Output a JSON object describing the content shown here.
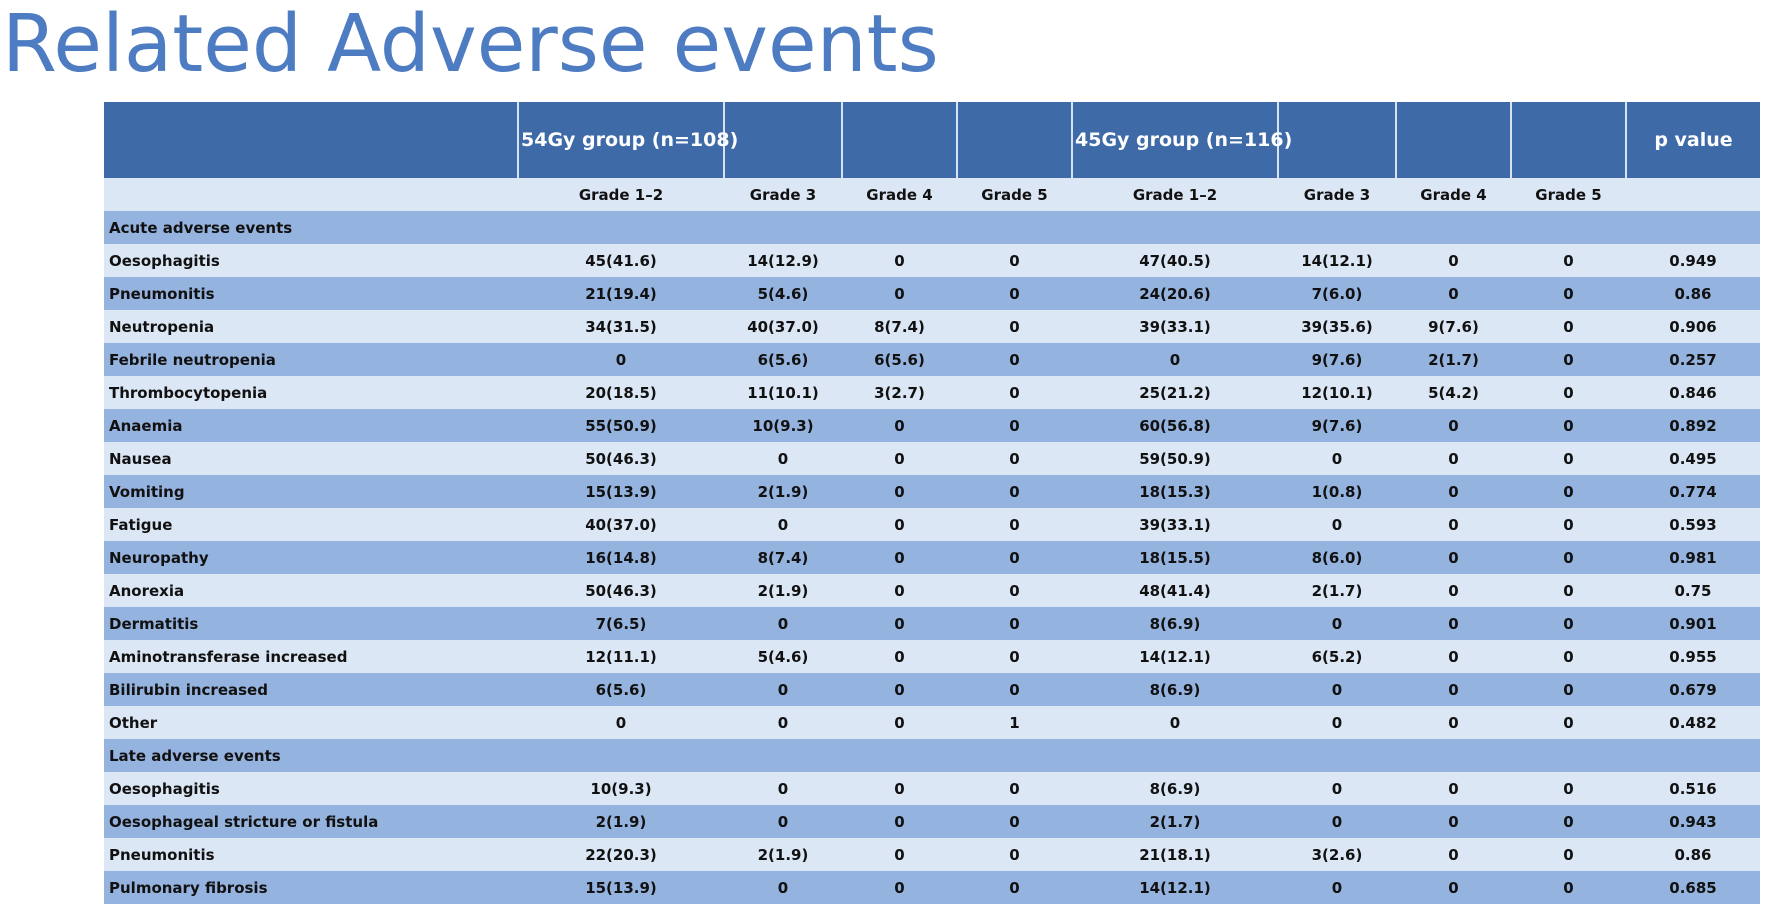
{
  "title": "Related Adverse events",
  "table": {
    "group_headers": [
      "",
      "54Gy  group  (n=108)",
      "",
      "",
      "",
      "45Gy  group  (n=116)",
      "",
      "",
      "",
      "p value"
    ],
    "grade_headers": [
      "",
      "Grade  1–2",
      "Grade  3",
      "Grade  4",
      "Grade  5",
      "Grade  1–2",
      "Grade  3",
      "Grade  4",
      "Grade  5",
      ""
    ],
    "rows": [
      {
        "kind": "section",
        "cells": [
          "Acute  adverse  events",
          "",
          "",
          "",
          "",
          "",
          "",
          "",
          "",
          ""
        ]
      },
      {
        "kind": "light",
        "cells": [
          "Oesophagitis",
          "45(41.6)",
          "14(12.9)",
          "0",
          "0",
          "47(40.5)",
          "14(12.1)",
          "0",
          "0",
          "0.949"
        ]
      },
      {
        "kind": "dark",
        "cells": [
          "Pneumonitis",
          "21(19.4)",
          "5(4.6)",
          "0",
          "0",
          "24(20.6)",
          "7(6.0)",
          "0",
          "0",
          "0.86"
        ]
      },
      {
        "kind": "light",
        "cells": [
          "Neutropenia",
          "34(31.5)",
          "40(37.0)",
          "8(7.4)",
          "0",
          "39(33.1)",
          "39(35.6)",
          "9(7.6)",
          "0",
          "0.906"
        ]
      },
      {
        "kind": "dark",
        "cells": [
          "Febrile  neutropenia",
          "0",
          "6(5.6)",
          "6(5.6)",
          "0",
          "0",
          "9(7.6)",
          "2(1.7)",
          "0",
          "0.257"
        ]
      },
      {
        "kind": "light",
        "cells": [
          "Thrombocytopenia",
          "20(18.5)",
          "11(10.1)",
          "3(2.7)",
          "0",
          "25(21.2)",
          "12(10.1)",
          "5(4.2)",
          "0",
          "0.846"
        ]
      },
      {
        "kind": "dark",
        "cells": [
          "Anaemia",
          "55(50.9)",
          "10(9.3)",
          "0",
          "0",
          "60(56.8)",
          "9(7.6)",
          "0",
          "0",
          "0.892"
        ]
      },
      {
        "kind": "light",
        "cells": [
          "Nausea",
          "50(46.3)",
          "0",
          "0",
          "0",
          "59(50.9)",
          "0",
          "0",
          "0",
          "0.495"
        ]
      },
      {
        "kind": "dark",
        "cells": [
          "Vomiting",
          "15(13.9)",
          "2(1.9)",
          "0",
          "0",
          "18(15.3)",
          "1(0.8)",
          "0",
          "0",
          "0.774"
        ]
      },
      {
        "kind": "light",
        "cells": [
          "Fatigue",
          "40(37.0)",
          "0",
          "0",
          "0",
          "39(33.1)",
          "0",
          "0",
          "0",
          "0.593"
        ]
      },
      {
        "kind": "dark",
        "cells": [
          "Neuropathy",
          "16(14.8)",
          "8(7.4)",
          "0",
          "0",
          "18(15.5)",
          "8(6.0)",
          "0",
          "0",
          "0.981"
        ]
      },
      {
        "kind": "light",
        "cells": [
          "Anorexia",
          "50(46.3)",
          "2(1.9)",
          "0",
          "0",
          "48(41.4)",
          "2(1.7)",
          "0",
          "0",
          "0.75"
        ]
      },
      {
        "kind": "dark",
        "cells": [
          "Dermatitis",
          "7(6.5)",
          "0",
          "0",
          "0",
          "8(6.9)",
          "0",
          "0",
          "0",
          "0.901"
        ]
      },
      {
        "kind": "light",
        "cells": [
          "Aminotransferase  increased",
          "12(11.1)",
          "5(4.6)",
          "0",
          "0",
          "14(12.1)",
          "6(5.2)",
          "0",
          "0",
          "0.955"
        ]
      },
      {
        "kind": "dark",
        "cells": [
          "Bilirubin  increased",
          "6(5.6)",
          "0",
          "0",
          "0",
          "8(6.9)",
          "0",
          "0",
          "0",
          "0.679"
        ]
      },
      {
        "kind": "light",
        "cells": [
          "Other",
          "0",
          "0",
          "0",
          "1",
          "0",
          "0",
          "0",
          "0",
          "0.482"
        ]
      },
      {
        "kind": "section",
        "cells": [
          "Late  adverse  events",
          "",
          "",
          "",
          "",
          "",
          "",
          "",
          "",
          ""
        ]
      },
      {
        "kind": "light",
        "cells": [
          "Oesophagitis",
          "10(9.3)",
          "0",
          "0",
          "0",
          "8(6.9)",
          "0",
          "0",
          "0",
          "0.516"
        ]
      },
      {
        "kind": "dark",
        "cells": [
          "Oesophageal  stricture  or  fistula",
          "2(1.9)",
          "0",
          "0",
          "0",
          "2(1.7)",
          "0",
          "0",
          "0",
          "0.943"
        ]
      },
      {
        "kind": "light",
        "cells": [
          "Pneumonitis",
          "22(20.3)",
          "2(1.9)",
          "0",
          "0",
          "21(18.1)",
          "3(2.6)",
          "0",
          "0",
          "0.86"
        ]
      },
      {
        "kind": "dark",
        "cells": [
          "Pulmonary  fibrosis",
          "15(13.9)",
          "0",
          "0",
          "0",
          "14(12.1)",
          "0",
          "0",
          "0",
          "0.685"
        ]
      }
    ]
  },
  "colors": {
    "title": "#4e7cc2",
    "header": "#3e6aa8",
    "row_light": "#dce7f6",
    "row_dark": "#95b3df"
  }
}
